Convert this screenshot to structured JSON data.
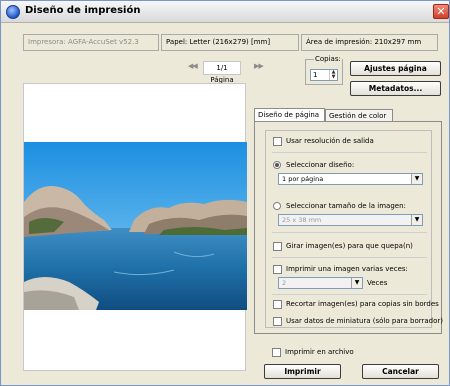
{
  "window": {
    "title": "Diseño de impresión",
    "close_glyph": "✕"
  },
  "info": {
    "printer": "Impresora: AGFA-AccuSet v52.3",
    "paper": "Papel:  Letter (216x279) [mm]",
    "area": "Área de impresión:  210x297 mm"
  },
  "pagination": {
    "prev_glyph": "◀◀",
    "label": "1/1 Página",
    "next_glyph": "▶▶"
  },
  "copies": {
    "label": "Copias:",
    "value": "1"
  },
  "buttons": {
    "page_setup": "Ajustes página",
    "metadata": "Metadatos...",
    "print": "Imprimir",
    "cancel": "Cancelar"
  },
  "tabs": [
    {
      "label": "Diseño de página",
      "active": true
    },
    {
      "label": "Gestión de color",
      "active": false
    }
  ],
  "options": {
    "use_output_resolution": "Usar resolución de salida",
    "select_layout": "Seleccionar diseño:",
    "layout_value": "1 por página",
    "select_image_size": "Seleccionar tamaño de la imagen:",
    "image_size_value": "25 x 38 mm",
    "rotate_to_fit": "Girar imagen(es) para que quepa(n)",
    "print_multiple": "Imprimir una imagen varias veces:",
    "times_value": "2",
    "times_label": "Veces",
    "crop_borderless": "Recortar imagen(es) para copias sin bordes",
    "use_thumbnail": "Usar datos de miniatura (sólo para borrador)"
  },
  "print_to_file": "Imprimir en archivo",
  "colors": {
    "close_red": "#d0402a",
    "sky": "#3aa0e0",
    "water": "#1f6fa8"
  }
}
